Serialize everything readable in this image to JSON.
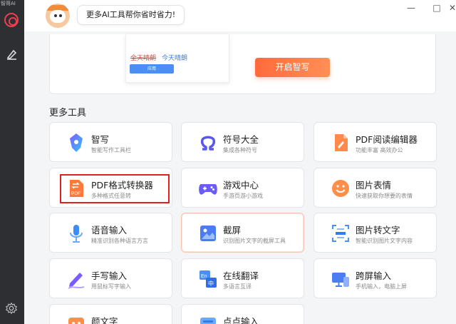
{
  "sidebar": {
    "brand": "智哥AI"
  },
  "header": {
    "greeting": "更多AI工具帮你省时省力!"
  },
  "banner": {
    "struck_text": "全天晴朗",
    "fixed_text": "今天晴朗",
    "mini_button": "应用",
    "start_button": "开启智写"
  },
  "section": {
    "title": "更多工具"
  },
  "tools": [
    {
      "name": "智写",
      "desc": "智能写作工具栏",
      "icon": "pen-nib-icon"
    },
    {
      "name": "符号大全",
      "desc": "集成各种符号",
      "icon": "omega-icon"
    },
    {
      "name": "PDF阅读编辑器",
      "desc": "功能丰富 高效办公",
      "icon": "pdf-edit-icon"
    },
    {
      "name": "PDF格式转换器",
      "desc": "多种格式任意转",
      "icon": "pdf-convert-icon"
    },
    {
      "name": "游戏中心",
      "desc": "手游页游小游戏",
      "icon": "gamepad-icon"
    },
    {
      "name": "图片表情",
      "desc": "快速获取你想要的表情",
      "icon": "smile-icon"
    },
    {
      "name": "语音输入",
      "desc": "精准识别各种语言方言",
      "icon": "microphone-icon"
    },
    {
      "name": "截屏",
      "desc": "识别图片文字的截屏工具",
      "icon": "screenshot-icon"
    },
    {
      "name": "图片转文字",
      "desc": "智能识别图片文字内容",
      "icon": "image-to-text-icon"
    },
    {
      "name": "手写输入",
      "desc": "用鼠标写字输入",
      "icon": "handwriting-icon"
    },
    {
      "name": "在线翻译",
      "desc": "多语言互译",
      "icon": "translate-icon"
    },
    {
      "name": "跨屏输入",
      "desc": "手机输入，电脑上屏",
      "icon": "cross-screen-icon"
    },
    {
      "name": "颜文字",
      "desc": "",
      "icon": "emoticon-icon"
    },
    {
      "name": "点点输入",
      "desc": "",
      "icon": "dot-input-icon"
    }
  ],
  "colors": {
    "accent": "#ff6a3d",
    "highlight_border": "#e0201b",
    "sidebar": "#2d2f33"
  }
}
